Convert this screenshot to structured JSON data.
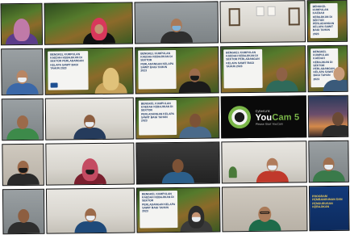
{
  "meeting": {
    "poster_text": "BENGKEL KUMPULAN KAEDAH KEBAJIKAN DI SEKTOR PERLADANGAN KELAPA SAWIT BAGI TAHUN 2023",
    "poster_text_alt": "BENGKEL KUMPULAN KAEDAH KEBAJIKAN DI SEKTOR PERLADANGAN KELAPA SAWIT BAGI TAHUN 2023"
  },
  "youcam": {
    "small_label": "CyberLink",
    "brand_a": "You",
    "brand_b": "Cam 5",
    "subtitle": "Please Start YouCam"
  },
  "blue_poster": {
    "text": "PROGRAM PEMBANGUNAN DAN PENGURUSAN KEBAJIKAN"
  },
  "colors": {
    "accent_green": "#7ab648",
    "poster_blue": "#16315e"
  }
}
